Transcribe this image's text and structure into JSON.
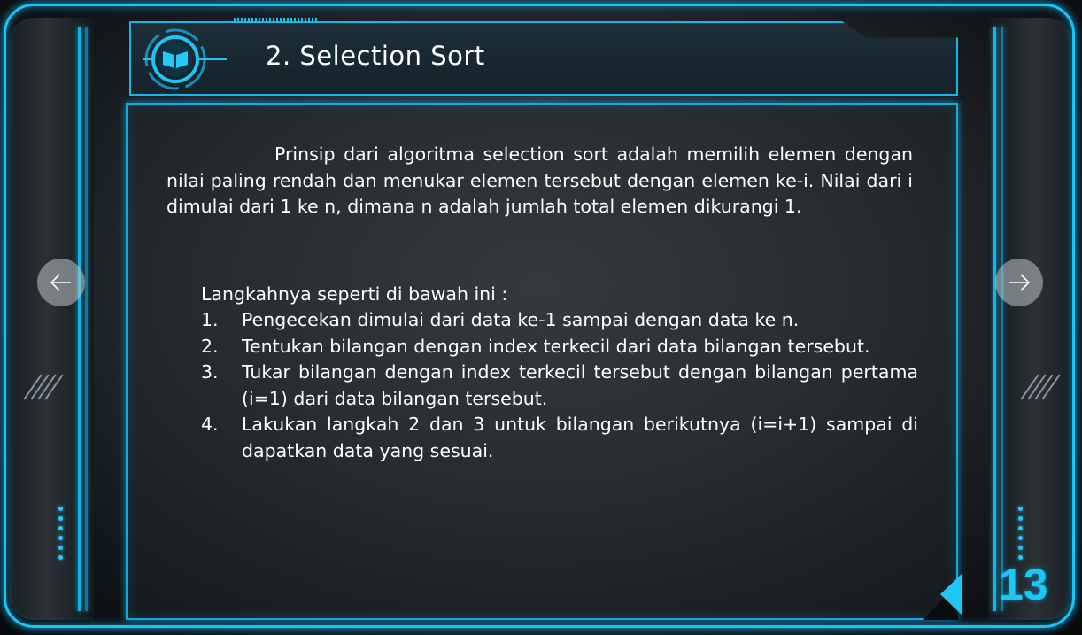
{
  "slide": {
    "title": "2. Selection Sort",
    "paragraph": "Prinsip dari algoritma selection sort adalah memilih elemen dengan nilai paling rendah dan menukar elemen tersebut dengan elemen ke-i. Nilai dari i dimulai dari 1 ke n, dimana n adalah jumlah total elemen dikurangi 1.",
    "steps_title": "Langkahnya seperti di bawah ini :",
    "steps": [
      {
        "number": "1.",
        "text": "Pengecekan dimulai dari data ke-1 sampai dengan data ke n."
      },
      {
        "number": "2.",
        "text": "Tentukan bilangan dengan index terkecil dari data bilangan tersebut."
      },
      {
        "number": "3.",
        "text": "Tukar bilangan dengan index terkecil tersebut dengan bilangan pertama (i=1) dari data bilangan tersebut."
      },
      {
        "number": "4.",
        "text": "Lakukan langkah 2 dan 3 untuk bilangan berikutnya (i=i+1) sampai di dapatkan data yang sesuai."
      }
    ],
    "page_number": "13"
  },
  "navigation": {
    "prev_icon": "arrow-left-icon",
    "next_icon": "arrow-right-icon",
    "back_icon": "triangle-left-icon"
  },
  "colors": {
    "accent": "#19c6f3",
    "page_number": "#1ec6f4",
    "text": "#ffffff",
    "background": "#2a2e31"
  }
}
